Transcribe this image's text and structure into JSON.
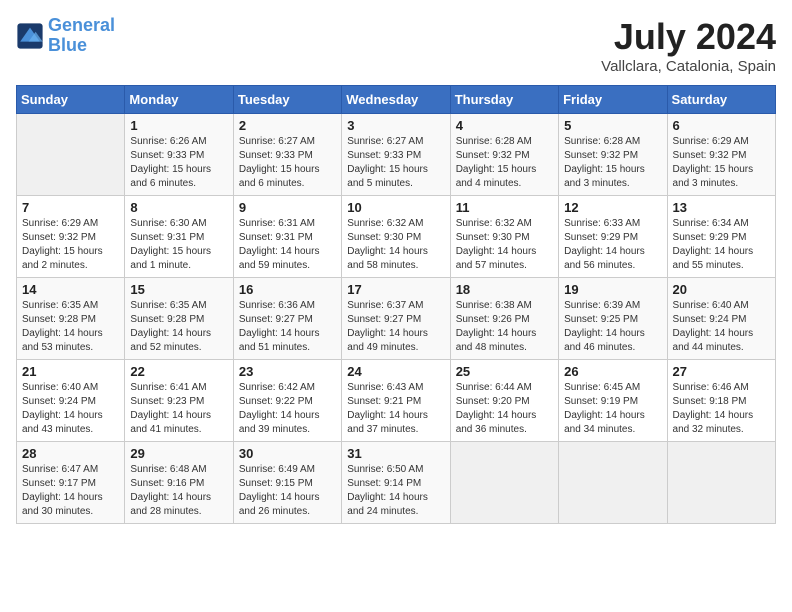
{
  "header": {
    "logo_line1": "General",
    "logo_line2": "Blue",
    "month_year": "July 2024",
    "location": "Vallclara, Catalonia, Spain"
  },
  "days_of_week": [
    "Sunday",
    "Monday",
    "Tuesday",
    "Wednesday",
    "Thursday",
    "Friday",
    "Saturday"
  ],
  "weeks": [
    [
      {
        "day": "",
        "info": ""
      },
      {
        "day": "1",
        "info": "Sunrise: 6:26 AM\nSunset: 9:33 PM\nDaylight: 15 hours\nand 6 minutes."
      },
      {
        "day": "2",
        "info": "Sunrise: 6:27 AM\nSunset: 9:33 PM\nDaylight: 15 hours\nand 6 minutes."
      },
      {
        "day": "3",
        "info": "Sunrise: 6:27 AM\nSunset: 9:33 PM\nDaylight: 15 hours\nand 5 minutes."
      },
      {
        "day": "4",
        "info": "Sunrise: 6:28 AM\nSunset: 9:32 PM\nDaylight: 15 hours\nand 4 minutes."
      },
      {
        "day": "5",
        "info": "Sunrise: 6:28 AM\nSunset: 9:32 PM\nDaylight: 15 hours\nand 3 minutes."
      },
      {
        "day": "6",
        "info": "Sunrise: 6:29 AM\nSunset: 9:32 PM\nDaylight: 15 hours\nand 3 minutes."
      }
    ],
    [
      {
        "day": "7",
        "info": "Sunrise: 6:29 AM\nSunset: 9:32 PM\nDaylight: 15 hours\nand 2 minutes."
      },
      {
        "day": "8",
        "info": "Sunrise: 6:30 AM\nSunset: 9:31 PM\nDaylight: 15 hours\nand 1 minute."
      },
      {
        "day": "9",
        "info": "Sunrise: 6:31 AM\nSunset: 9:31 PM\nDaylight: 14 hours\nand 59 minutes."
      },
      {
        "day": "10",
        "info": "Sunrise: 6:32 AM\nSunset: 9:30 PM\nDaylight: 14 hours\nand 58 minutes."
      },
      {
        "day": "11",
        "info": "Sunrise: 6:32 AM\nSunset: 9:30 PM\nDaylight: 14 hours\nand 57 minutes."
      },
      {
        "day": "12",
        "info": "Sunrise: 6:33 AM\nSunset: 9:29 PM\nDaylight: 14 hours\nand 56 minutes."
      },
      {
        "day": "13",
        "info": "Sunrise: 6:34 AM\nSunset: 9:29 PM\nDaylight: 14 hours\nand 55 minutes."
      }
    ],
    [
      {
        "day": "14",
        "info": "Sunrise: 6:35 AM\nSunset: 9:28 PM\nDaylight: 14 hours\nand 53 minutes."
      },
      {
        "day": "15",
        "info": "Sunrise: 6:35 AM\nSunset: 9:28 PM\nDaylight: 14 hours\nand 52 minutes."
      },
      {
        "day": "16",
        "info": "Sunrise: 6:36 AM\nSunset: 9:27 PM\nDaylight: 14 hours\nand 51 minutes."
      },
      {
        "day": "17",
        "info": "Sunrise: 6:37 AM\nSunset: 9:27 PM\nDaylight: 14 hours\nand 49 minutes."
      },
      {
        "day": "18",
        "info": "Sunrise: 6:38 AM\nSunset: 9:26 PM\nDaylight: 14 hours\nand 48 minutes."
      },
      {
        "day": "19",
        "info": "Sunrise: 6:39 AM\nSunset: 9:25 PM\nDaylight: 14 hours\nand 46 minutes."
      },
      {
        "day": "20",
        "info": "Sunrise: 6:40 AM\nSunset: 9:24 PM\nDaylight: 14 hours\nand 44 minutes."
      }
    ],
    [
      {
        "day": "21",
        "info": "Sunrise: 6:40 AM\nSunset: 9:24 PM\nDaylight: 14 hours\nand 43 minutes."
      },
      {
        "day": "22",
        "info": "Sunrise: 6:41 AM\nSunset: 9:23 PM\nDaylight: 14 hours\nand 41 minutes."
      },
      {
        "day": "23",
        "info": "Sunrise: 6:42 AM\nSunset: 9:22 PM\nDaylight: 14 hours\nand 39 minutes."
      },
      {
        "day": "24",
        "info": "Sunrise: 6:43 AM\nSunset: 9:21 PM\nDaylight: 14 hours\nand 37 minutes."
      },
      {
        "day": "25",
        "info": "Sunrise: 6:44 AM\nSunset: 9:20 PM\nDaylight: 14 hours\nand 36 minutes."
      },
      {
        "day": "26",
        "info": "Sunrise: 6:45 AM\nSunset: 9:19 PM\nDaylight: 14 hours\nand 34 minutes."
      },
      {
        "day": "27",
        "info": "Sunrise: 6:46 AM\nSunset: 9:18 PM\nDaylight: 14 hours\nand 32 minutes."
      }
    ],
    [
      {
        "day": "28",
        "info": "Sunrise: 6:47 AM\nSunset: 9:17 PM\nDaylight: 14 hours\nand 30 minutes."
      },
      {
        "day": "29",
        "info": "Sunrise: 6:48 AM\nSunset: 9:16 PM\nDaylight: 14 hours\nand 28 minutes."
      },
      {
        "day": "30",
        "info": "Sunrise: 6:49 AM\nSunset: 9:15 PM\nDaylight: 14 hours\nand 26 minutes."
      },
      {
        "day": "31",
        "info": "Sunrise: 6:50 AM\nSunset: 9:14 PM\nDaylight: 14 hours\nand 24 minutes."
      },
      {
        "day": "",
        "info": ""
      },
      {
        "day": "",
        "info": ""
      },
      {
        "day": "",
        "info": ""
      }
    ]
  ]
}
